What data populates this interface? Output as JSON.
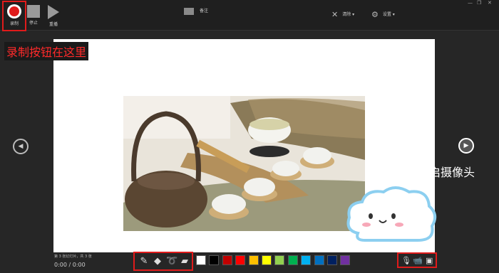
{
  "toolbar": {
    "record_label": "录制",
    "stop_label": "停止",
    "replay_label": "重播",
    "notes_label": "备注",
    "clear_label": "清除 ▾",
    "settings_label": "设置 ▾",
    "minimize": "—",
    "restore": "❐",
    "close": "✕"
  },
  "annotations": {
    "record_here": "录制按钮在这里",
    "camera": "可开启摄像头"
  },
  "status": {
    "slide_info": "第 3 张幻灯片，共 3 张",
    "time": "0:00 / 0:00"
  },
  "icons": {
    "pen_tools": [
      "pen-icon",
      "eraser-icon",
      "lasso-icon",
      "highlighter-icon"
    ],
    "media": [
      "microphone-icon",
      "camera-icon",
      "camera-preview-icon"
    ]
  },
  "colors": {
    "accent_red": "#e01b1b",
    "swatches": [
      "#ffffff",
      "#000000",
      "#c00000",
      "#ff0000",
      "#ffc000",
      "#ffff00",
      "#92d050",
      "#00b050",
      "#00b0f0",
      "#0070c0",
      "#002060",
      "#7030a0"
    ]
  }
}
